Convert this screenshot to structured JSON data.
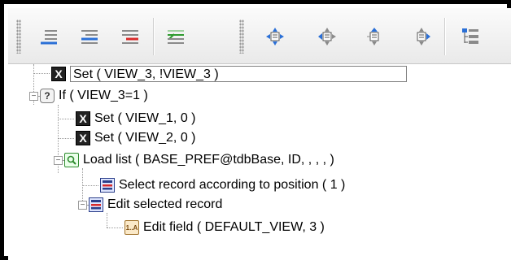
{
  "toolbar": {
    "buttons": [
      {
        "icon": "list-indent-icon"
      },
      {
        "icon": "list-outdent-icon"
      },
      {
        "icon": "list-delete-icon"
      },
      {
        "icon": "list-comment-icon"
      },
      {
        "icon": "move-all-icon"
      },
      {
        "icon": "move-left-icon"
      },
      {
        "icon": "move-up-icon"
      },
      {
        "icon": "move-right-icon"
      },
      {
        "icon": "tree-view-icon"
      }
    ]
  },
  "tree": {
    "nodes": [
      {
        "label": "Set ( VIEW_3, !VIEW_3 )",
        "icon": "x-command-icon",
        "editing": true
      },
      {
        "label": "If ( VIEW_3=1 )",
        "icon": "question-icon",
        "expander": "−"
      },
      {
        "label": "Set ( VIEW_1, 0 )",
        "icon": "x-command-icon"
      },
      {
        "label": "Set ( VIEW_2, 0 )",
        "icon": "x-command-icon"
      },
      {
        "label": "Load list ( BASE_PREF@tdbBase, ID, , , ,  )",
        "icon": "load-list-icon",
        "expander": "−"
      },
      {
        "label": "Select record according to position ( 1 )",
        "icon": "record-icon"
      },
      {
        "label": "Edit selected record",
        "icon": "record-icon",
        "expander": "−"
      },
      {
        "label": "Edit field ( DEFAULT_VIEW, 3 )",
        "icon": "field-icon",
        "icon_text": "1..A"
      }
    ]
  }
}
